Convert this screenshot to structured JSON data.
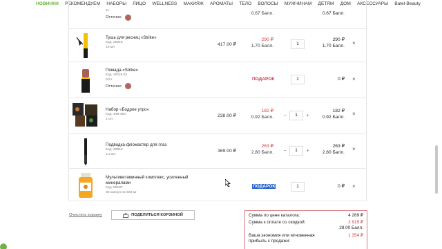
{
  "nav": [
    "НОВИНКИ",
    "РЕКОМЕНДУЕМ",
    "НАБОРЫ",
    "ЛИЦО",
    "WELLNESS",
    "МАКИЯЖ",
    "АРОМАТЫ",
    "ТЕЛО",
    "ВОЛОСЫ",
    "МУЖЧИНАМ",
    "ДЕТЯМ",
    "ДОМ",
    "АКСЕССУАРЫ",
    "Batel-Beauty"
  ],
  "partial_row": {
    "vol": "3 г",
    "shade_label": "Оттенок:",
    "sale_points": "0.67 Балл.",
    "total_points": "0.67 Балл."
  },
  "items": [
    {
      "name": "Тушь для ресниц «Strike»",
      "code": "Код: 20216",
      "vol": "10 мл",
      "base_price": "417.00 ₽",
      "sale_price": "290 ₽",
      "sale_points": "1.70 Балл.",
      "qty": "1",
      "total_price": "290 ₽",
      "total_points": "1.70 Балл."
    },
    {
      "name": "Помада «Strike»",
      "code": "Код: 20119.02",
      "vol": "3,5 г",
      "shade_label": "Оттенок:",
      "gift": "ПОДАРОК",
      "qty": "1",
      "total_price": "0 ₽"
    },
    {
      "name": "Набор «Бодрое утро»",
      "code": "Код: 448-464",
      "vol": "1 шт.",
      "base_price": "238.00 ₽",
      "sale_price": "182 ₽",
      "sale_points": "0.92 Балл.",
      "qty": "1",
      "total_price": "182 ₽",
      "total_points": "0.92 Балл."
    },
    {
      "name": "Подводка-фломастер для глаз",
      "code": "Код: 20810",
      "vol": "1,5 мл",
      "base_price": "369.00 ₽",
      "sale_price": "263 ₽",
      "sale_points": "2.80 Балл.",
      "qty": "1",
      "total_price": "263 ₽",
      "total_points": "2.80 Балл."
    },
    {
      "name": "Мультивитаминный комплекс, усиленный минералами",
      "code": "Код: 50187",
      "vol": "30 капсул по 500 мг",
      "gift": "ПОДАРОК",
      "qty": "1",
      "total_price": "0 ₽"
    }
  ],
  "controls": {
    "minus": "−",
    "plus": "+",
    "remove": "×"
  },
  "bottom": {
    "clear_cart": "Очистить корзину",
    "share": "ПОДЕЛИТЬСЯ КОРЗИНОЙ"
  },
  "summary": {
    "catalog_label": "Сумма по цене каталога:",
    "catalog_value": "4 269 ₽",
    "discount_label": "Сумма к оплате со скидкой:",
    "discount_value": "2 915 ₽",
    "points_value": "28.00 Балл.",
    "savings_label": "Ваша экономия или мгновенная прибыль с продажи:",
    "savings_value": "1 354 ₽"
  },
  "colors": {
    "accent_green": "#6cb43f",
    "sale_red": "#d63a3a",
    "gift_red": "#c92f4a",
    "selection_blue": "#2862c9"
  }
}
